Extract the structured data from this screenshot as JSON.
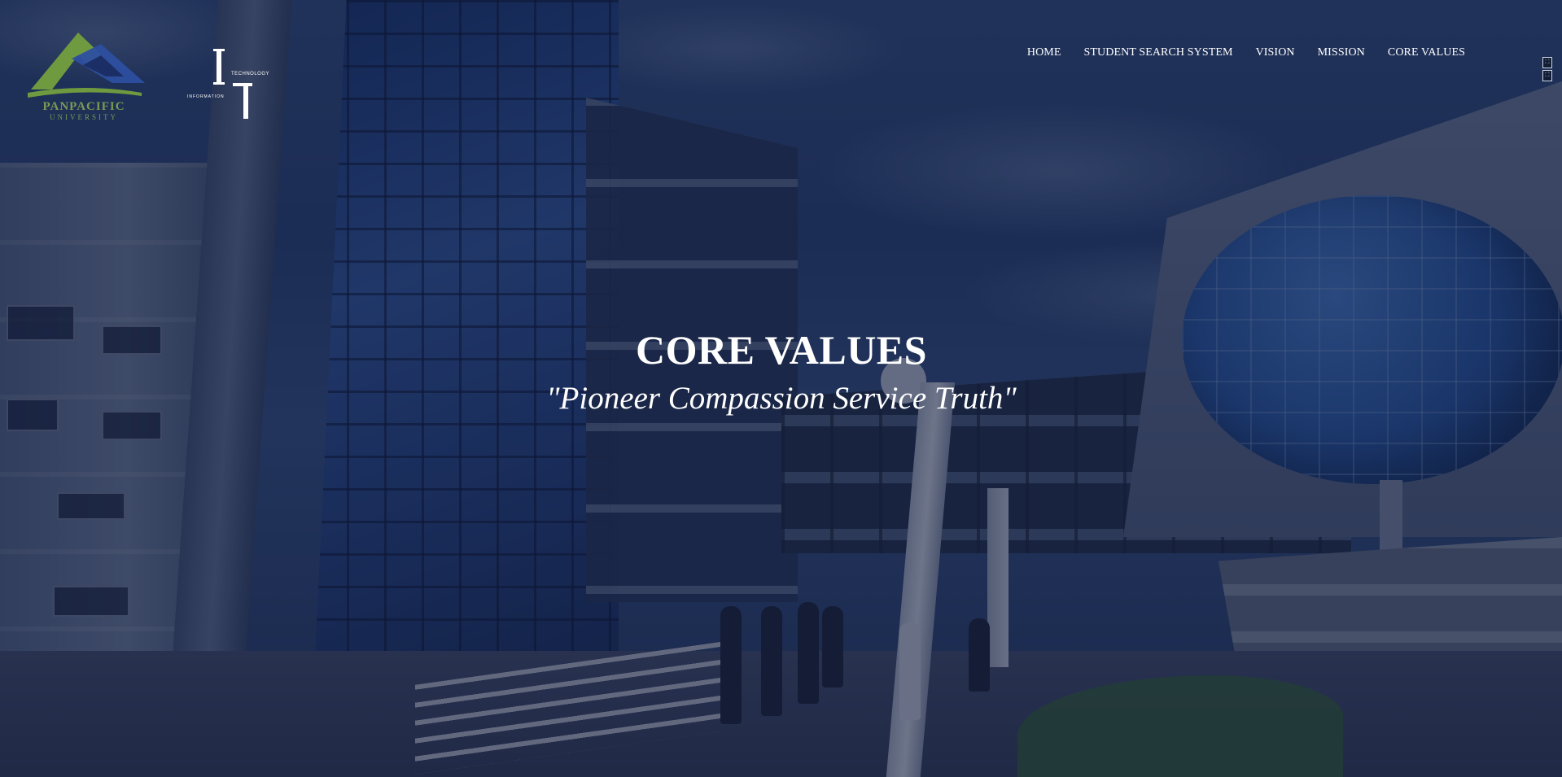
{
  "header": {
    "university_logo": {
      "name": "PANPACIFIC",
      "subname": "UNIVERSITY"
    },
    "it_logo": {
      "word_top": "TECHNOLOGY",
      "word_bottom": "INFORMATION"
    }
  },
  "nav": {
    "items": [
      {
        "label": "HOME"
      },
      {
        "label": "STUDENT SEARCH SYSTEM"
      },
      {
        "label": "VISION"
      },
      {
        "label": "MISSION"
      },
      {
        "label": "CORE VALUES"
      }
    ]
  },
  "side_widget": {
    "icons": [
      "expand-icon",
      "collapse-icon"
    ]
  },
  "hero": {
    "title": "CORE VALUES",
    "subtitle": "\"Pioneer Compassion Service Truth\""
  },
  "colors": {
    "overlay": "#0c1634",
    "nav_text": "#ffffff",
    "logo_green": "#7a9a54",
    "logo_blue": "#2d4fa0"
  }
}
